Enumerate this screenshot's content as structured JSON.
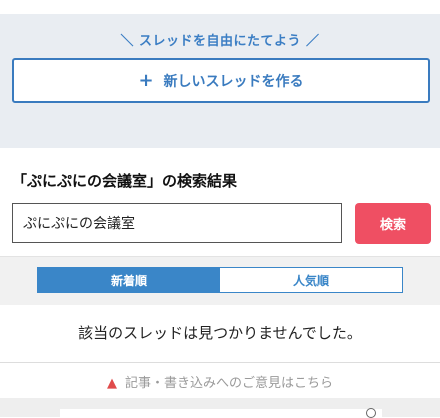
{
  "create_panel": {
    "tagline": "＼ スレッドを自由にたてよう ／",
    "new_thread_icon": "plus-icon",
    "new_thread_label": "新しいスレッドを作る"
  },
  "search": {
    "results_title": "「ぷにぷにの会議室」の検索結果",
    "input_value": "ぷにぷにの会議室",
    "button_label": "検索",
    "button_color": "#ef4f63"
  },
  "sort": {
    "tabs": [
      {
        "label": "新着順",
        "active": true
      },
      {
        "label": "人気順",
        "active": false
      }
    ],
    "accent_color": "#3a86c8"
  },
  "results": {
    "empty_message": "該当のスレッドは見つかりませんでした。"
  },
  "footer": {
    "feedback_icon": "warning-icon",
    "feedback_label": "記事・書き込みへのご意見はこちら"
  }
}
